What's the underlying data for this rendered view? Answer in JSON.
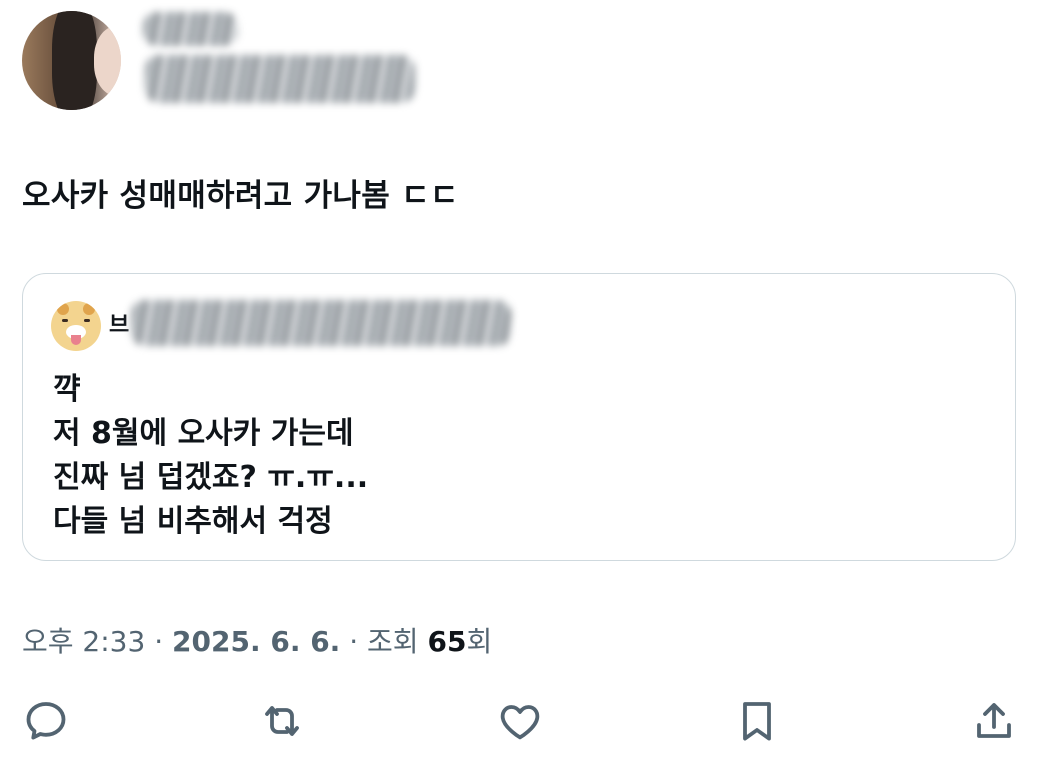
{
  "author": {
    "avatar_icon": "profile-photo"
  },
  "tweet": {
    "text": "오사카 성매매하려고 가나봄 ㄷㄷ"
  },
  "quote": {
    "avatar_icon": "tiger-cartoon-avatar",
    "name_visible_char": "브",
    "lines": [
      "꺅",
      "저 8월에 오사카 가는데",
      "진짜 넘 덥겠죠? ㅠ.ㅠ...",
      "다들 넘 비추해서 걱정"
    ]
  },
  "meta": {
    "time": "오후 2:33",
    "separator": " · ",
    "date": "2025. 6. 6.",
    "views_label": "조회",
    "views_count": "65",
    "views_suffix": "회"
  },
  "actions": [
    {
      "icon": "reply-icon"
    },
    {
      "icon": "retweet-icon"
    },
    {
      "icon": "like-icon"
    },
    {
      "icon": "bookmark-icon"
    },
    {
      "icon": "share-icon"
    }
  ],
  "colors": {
    "text": "#0f1419",
    "secondary": "#536471",
    "border": "#cfd9de"
  }
}
